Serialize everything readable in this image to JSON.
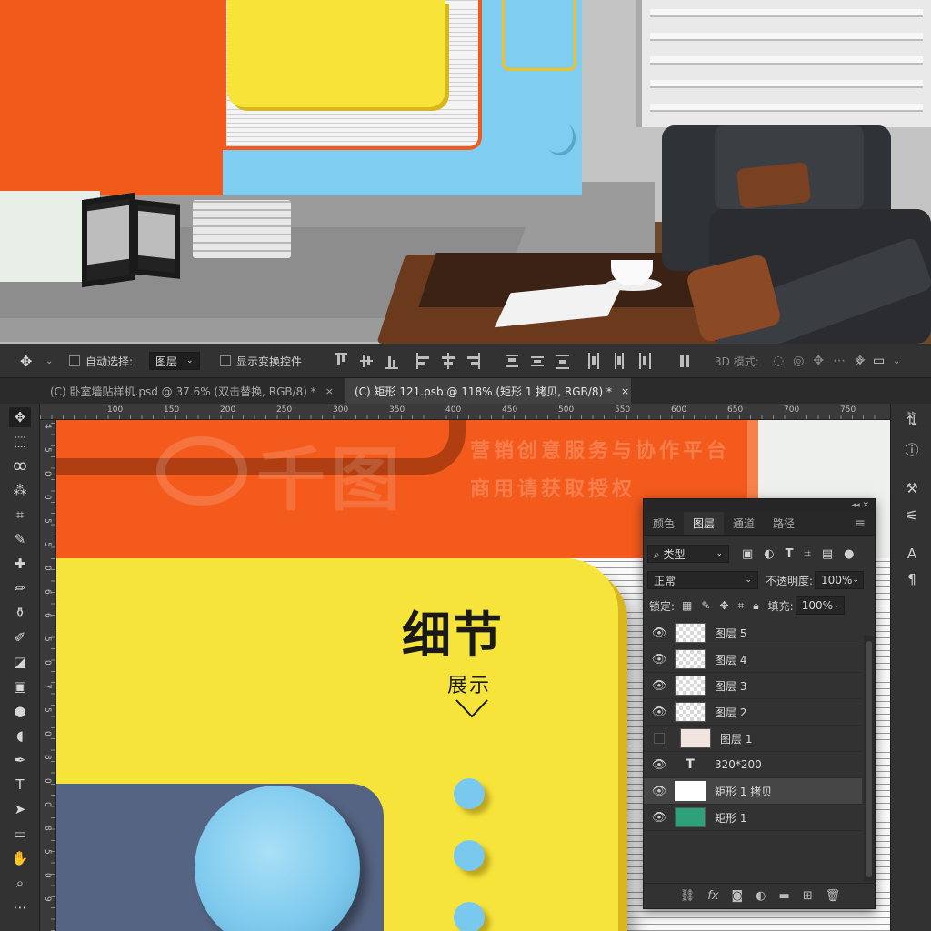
{
  "options_bar": {
    "auto_select_label": "自动选择:",
    "auto_select_value": "图层",
    "show_transform_label": "显示变换控件",
    "mode_3d_label": "3D 模式:"
  },
  "tabs": [
    {
      "label": "(C) 卧室墙贴样机.psd @ 37.6% (双击替换, RGB/8) *",
      "close": "×"
    },
    {
      "label": "(C) 矩形 121.psb @ 118% (矩形 1 拷贝, RGB/8) *",
      "close": "×"
    }
  ],
  "ruler": {
    "top_labels": [
      "100",
      "150",
      "200",
      "250",
      "300",
      "350",
      "400",
      "450",
      "500",
      "550",
      "600",
      "650",
      "700",
      "750"
    ],
    "left_labels": [
      "4",
      "5",
      "0",
      "0",
      "5",
      "5",
      "0",
      "6",
      "6",
      "5",
      "0",
      "7",
      "5",
      "0",
      "8",
      "0",
      "0",
      "8",
      "5",
      "0",
      "9"
    ]
  },
  "canvas": {
    "title": "细节",
    "subtitle": "展示",
    "watermark_big": "千图",
    "watermark_line1": "营销创意服务与协作平台",
    "watermark_line2": "商用请获取授权"
  },
  "layers_panel": {
    "collapse": "◂◂  ✕",
    "tabs": [
      "颜色",
      "图层",
      "通道",
      "路径"
    ],
    "active_tab": "图层",
    "filter_kind": "类型",
    "blend_mode": "正常",
    "opacity_label": "不透明度:",
    "opacity_value": "100%",
    "lock_label": "锁定:",
    "fill_label": "填充:",
    "fill_value": "100%",
    "layers": [
      {
        "name": "图层 5",
        "visible": true,
        "thumb": "checker"
      },
      {
        "name": "图层 4",
        "visible": true,
        "thumb": "checker"
      },
      {
        "name": "图层 3",
        "visible": true,
        "thumb": "checker"
      },
      {
        "name": "图层 2",
        "visible": true,
        "thumb": "checker"
      },
      {
        "name": "图层 1",
        "visible": false,
        "thumb": "pink"
      },
      {
        "name": "320*200",
        "visible": true,
        "thumb": "text"
      },
      {
        "name": "矩形 1 拷贝",
        "visible": true,
        "thumb": "white",
        "selected": true
      },
      {
        "name": "矩形 1",
        "visible": true,
        "thumb": "green"
      }
    ],
    "footer_icons": [
      "link-icon",
      "fx-icon",
      "mask-icon",
      "adjustment-icon",
      "folder-icon",
      "new-layer-icon",
      "trash-icon"
    ]
  },
  "colors": {
    "orange": "#f45a1c",
    "yellow": "#f7e43a",
    "sky_blue": "#7fcaee",
    "slate": "#556482",
    "selected_layer_bg": "#454545"
  }
}
